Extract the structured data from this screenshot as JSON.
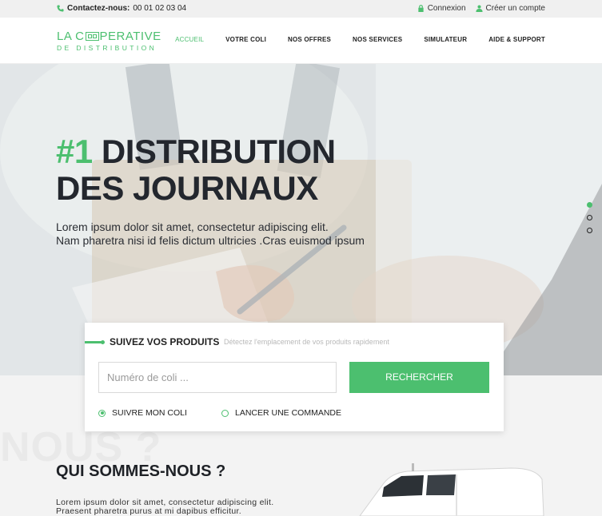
{
  "topbar": {
    "contact_label": "Contactez-nous:",
    "phone": "00 01 02 03 04",
    "login": "Connexion",
    "signup": "Créer un compte"
  },
  "logo": {
    "line1_a": "LA C",
    "line1_b": "PERATIVE",
    "line2": "DE DISTRIBUTION"
  },
  "nav": {
    "items": [
      "ACCUEIL",
      "VOTRE COLI",
      "NOS OFFRES",
      "NOS SERVICES",
      "SIMULATEUR",
      "AIDE & SUPPORT"
    ],
    "active": "ACCUEIL"
  },
  "hero": {
    "number": "#1",
    "title_line1": "DISTRIBUTION",
    "title_line2": "DES JOURNAUX",
    "sub_line1": "Lorem ipsum dolor sit amet, consectetur adipiscing elit.",
    "sub_line2": "Nam pharetra nisi id felis dictum ultricies .Cras euismod ipsum",
    "slides": 3,
    "active_slide": 1
  },
  "tracking": {
    "title": "SUIVEZ VOS PRODUITS",
    "hint": "Détectez l'emplacement de vos produits rapidement",
    "placeholder": "Numéro de coli ...",
    "button": "RECHERCHER",
    "option1": "SUIVRE MON COLI",
    "option2": "LANCER UNE COMMANDE",
    "selected": "SUIVRE MON COLI"
  },
  "about": {
    "ghost": "NOUS ?",
    "title": "QUI SOMMES-NOUS ?",
    "text_line1": "Lorem ipsum dolor sit amet, consectetur adipiscing elit.",
    "text_line2": "Praesent pharetra purus at mi dapibus efficitur."
  },
  "colors": {
    "accent": "#4cbf6f",
    "dark": "#23272e"
  }
}
